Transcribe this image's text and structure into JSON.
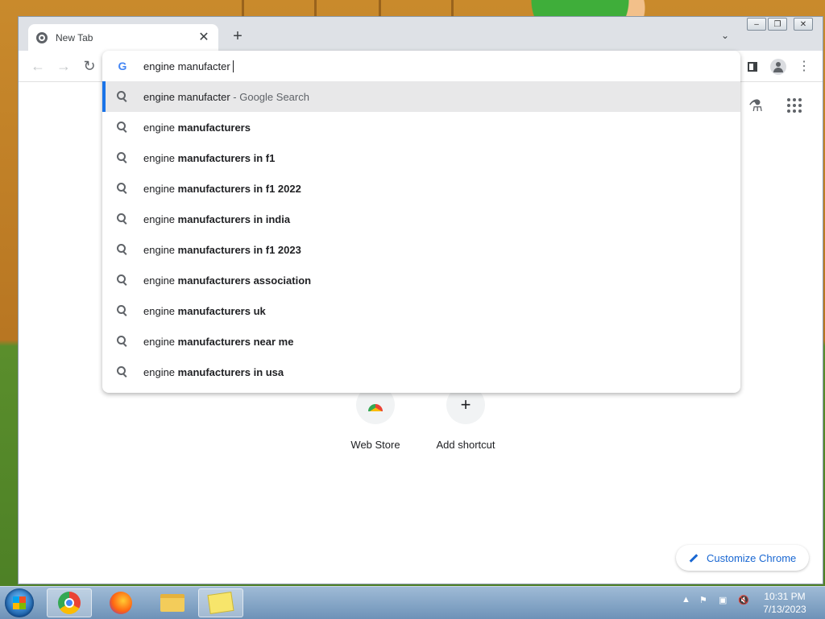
{
  "browser": {
    "tab_title": "New Tab",
    "tab_close": "✕",
    "new_tab": "+",
    "tab_search": "⌄",
    "window_controls": {
      "minimize": "‒",
      "maximize": "❐",
      "close": "✕"
    },
    "nav": {
      "back": "←",
      "forward": "→",
      "reload": "↻"
    }
  },
  "omnibox": {
    "input_value": "engine manufacter",
    "suggestions": [
      {
        "plain": "engine manufacter",
        "bold": "",
        "hint": " - Google Search",
        "selected": true
      },
      {
        "plain": "engine ",
        "bold": "manufacturers"
      },
      {
        "plain": "engine ",
        "bold": "manufacturers in f1"
      },
      {
        "plain": "engine ",
        "bold": "manufacturers in f1 2022"
      },
      {
        "plain": "engine ",
        "bold": "manufacturers in india"
      },
      {
        "plain": "engine ",
        "bold": "manufacturers in f1 2023"
      },
      {
        "plain": "engine ",
        "bold": "manufacturers association"
      },
      {
        "plain": "engine ",
        "bold": "manufacturers uk"
      },
      {
        "plain": "engine ",
        "bold": "manufacturers near me"
      },
      {
        "plain": "engine ",
        "bold": "manufacturers in usa"
      }
    ]
  },
  "ntp": {
    "shortcuts": [
      {
        "label": "Web Store",
        "icon": "webstore-icon"
      },
      {
        "label": "Add shortcut",
        "icon": "plus-icon",
        "glyph": "+"
      }
    ],
    "customize_label": "Customize Chrome",
    "labs_icon": "⚗"
  },
  "taskbar": {
    "time": "10:31 PM",
    "date": "7/13/2023",
    "apps": [
      "chrome",
      "firefox",
      "file-explorer",
      "sticky-notes"
    ]
  },
  "colors": {
    "accent": "#1a73e8",
    "link": "#1967d2"
  }
}
